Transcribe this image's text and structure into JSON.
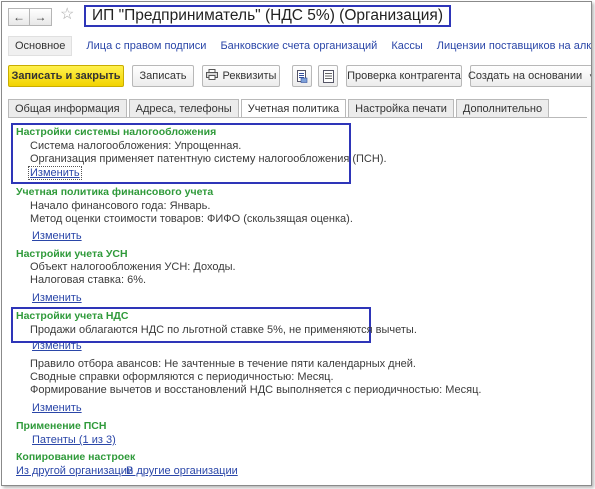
{
  "window": {
    "title": "ИП \"Предприниматель\" (НДС 5%) (Организация)",
    "back_icon": "←",
    "forward_icon": "→",
    "star_icon": "☆"
  },
  "sections": {
    "main": "Основное",
    "links": [
      "Лица с правом подписи",
      "Банковские счета организаций",
      "Кассы",
      "Лицензии поставщиков на алкогольную и спиртосо"
    ]
  },
  "toolbar": {
    "save_close": "Записать и закрыть",
    "save": "Записать",
    "requisites": "Реквизиты",
    "check_contractor": "Проверка контрагента",
    "create_based_on": "Создать на основании"
  },
  "tabs": [
    "Общая информация",
    "Адреса, телефоны",
    "Учетная политика",
    "Настройка печати",
    "Дополнительно"
  ],
  "policy": {
    "tax_system": {
      "title": "Настройки системы налогообложения",
      "lines": [
        "Система налогообложения: Упрощенная.",
        "Организация применяет патентную систему налогообложения (ПСН)."
      ],
      "edit": "Изменить"
    },
    "fin_policy": {
      "title": "Учетная политика финансового учета",
      "lines": [
        "Начало финансового года: Январь.",
        "Метод оценки стоимости товаров: ФИФО (скользящая оценка)."
      ],
      "edit": "Изменить"
    },
    "usn": {
      "title": "Настройки учета УСН",
      "lines": [
        "Объект налогообложения УСН: Доходы.",
        "Налоговая ставка: 6%."
      ],
      "edit": "Изменить"
    },
    "vat": {
      "title": "Настройки учета НДС",
      "lines": [
        "Продажи облагаются НДС по льготной ставке 5%, не применяются вычеты.",
        "Правило отбора авансов: Не зачтенные в течение пяти календарных дней.",
        "Сводные справки оформляются с периодичностью: Месяц.",
        "Формирование вычетов и восстановлений НДС выполняется с периодичностью: Месяц."
      ],
      "edit1": "Изменить",
      "edit2": "Изменить"
    },
    "psn": {
      "title": "Применение ПСН",
      "link": "Патенты (1 из 3)"
    },
    "copy": {
      "title": "Копирование настроек",
      "from": "Из другой организации",
      "to": "В другие организации"
    }
  }
}
